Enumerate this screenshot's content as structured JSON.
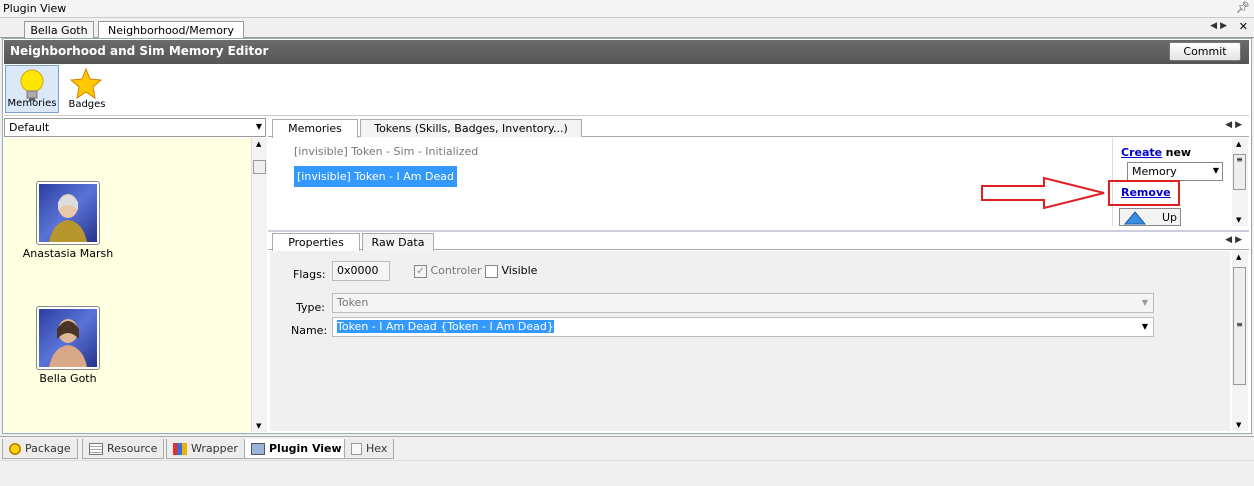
{
  "window": {
    "title": "Plugin View"
  },
  "doc_tabs": [
    "Bella Goth",
    "Neighborhood/Memory"
  ],
  "editor": {
    "title": "Neighborhood and Sim Memory Editor",
    "commit_label": "Commit"
  },
  "toolbar": {
    "memories_label": "Memories",
    "badges_label": "Badges"
  },
  "left": {
    "combo_value": "Default",
    "sims": [
      {
        "name": "Anastasia Marsh"
      },
      {
        "name": "Bella Goth"
      }
    ]
  },
  "top_tabs": [
    "Memories",
    "Tokens (Skills, Badges, Inventory...)"
  ],
  "memories": [
    {
      "text": "[invisible] Token - Sim - Initialized"
    },
    {
      "text": "[invisible] Token - I Am Dead"
    }
  ],
  "side": {
    "create_link": "Create",
    "create_suffix": "new",
    "type_value": "Memory",
    "remove_link": "Remove",
    "up_label": "Up"
  },
  "lower_tabs": [
    "Properties",
    "Raw Data"
  ],
  "props": {
    "flags_label": "Flags:",
    "flags_value": "0x0000",
    "controler_label": "Controler",
    "visible_label": "Visible",
    "type_label": "Type:",
    "type_value": "Token",
    "name_label": "Name:",
    "name_value": "Token - I Am Dead {Token - I Am Dead}"
  },
  "bottom_tabs": [
    "Package",
    "Resource",
    "Wrapper",
    "Plugin View",
    "Hex"
  ],
  "colors": {
    "header": "#5f5f5f",
    "selection": "#3399ff",
    "annotation": "#e02020",
    "sim_list_bg": "#ffffe1"
  }
}
